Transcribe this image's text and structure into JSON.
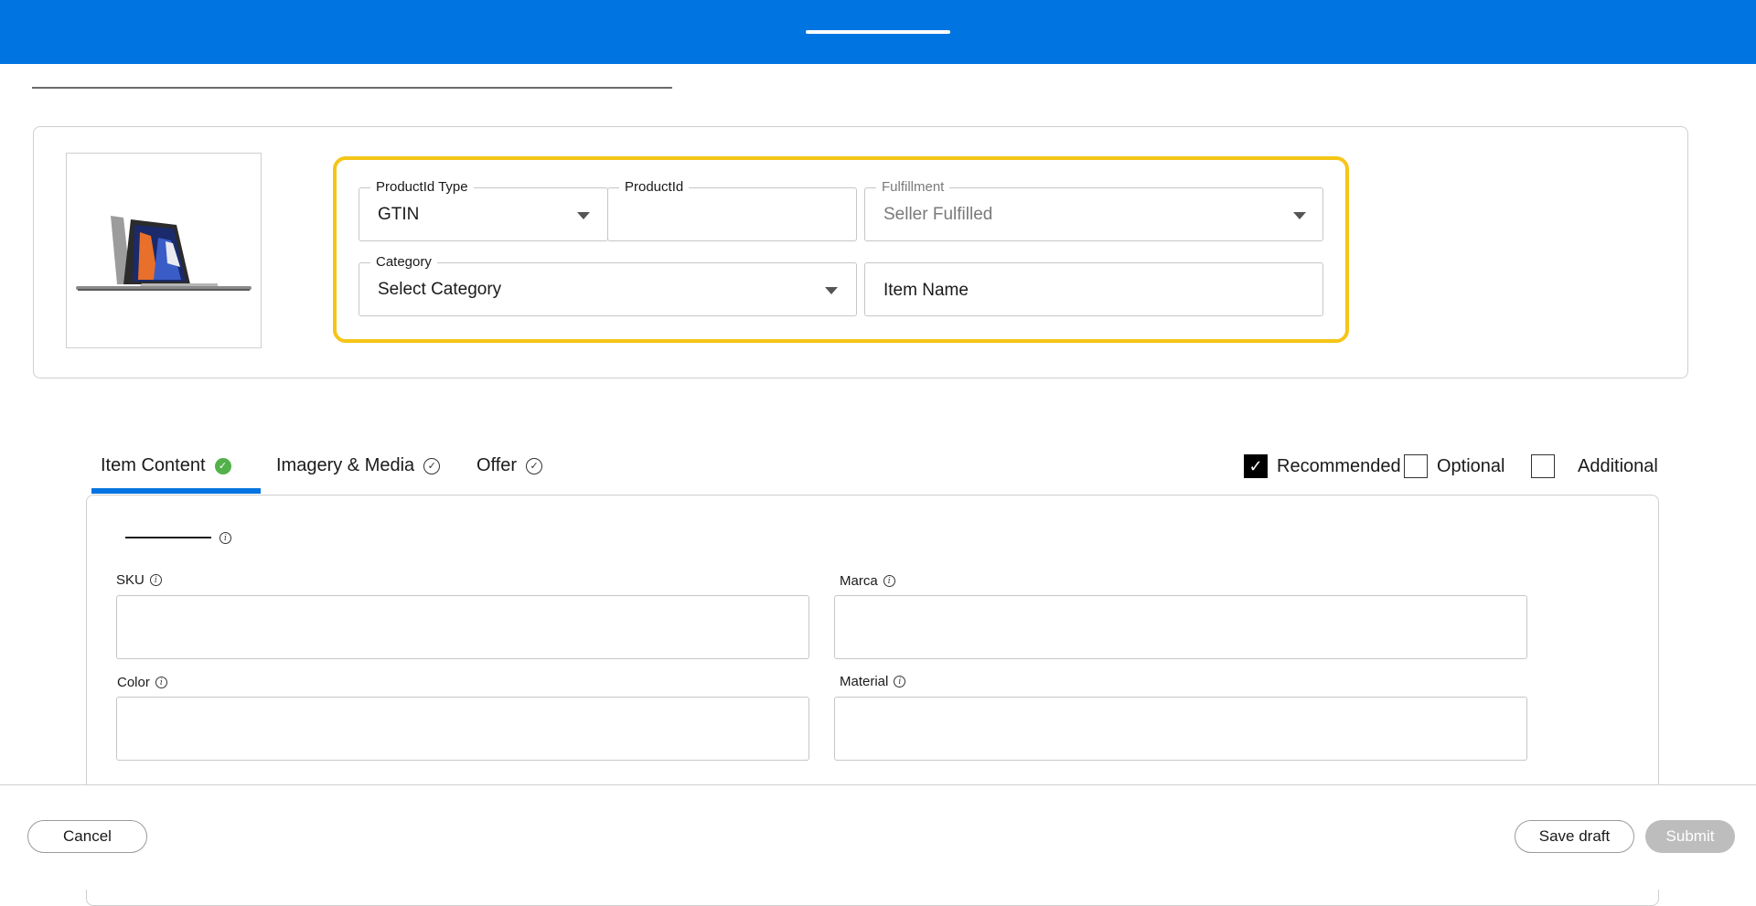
{
  "product_setup": {
    "productid_type": {
      "label": "ProductId Type",
      "value": "GTIN"
    },
    "productid": {
      "label": "ProductId",
      "value": ""
    },
    "fulfillment": {
      "label": "Fulfillment",
      "value": "Seller Fulfilled"
    },
    "category": {
      "label": "Category",
      "value": "Select Category"
    },
    "item_name": {
      "placeholder": "Item Name"
    }
  },
  "tabs": [
    {
      "label": "Item Content",
      "status": "complete",
      "active": true
    },
    {
      "label": "Imagery & Media",
      "status": "pending"
    },
    {
      "label": "Offer",
      "status": "pending"
    }
  ],
  "filters": [
    {
      "label": "Recommended",
      "checked": true
    },
    {
      "label": "Optional",
      "checked": false
    },
    {
      "label": "Additional",
      "checked": false
    }
  ],
  "fields": {
    "sku": {
      "label": "SKU",
      "value": ""
    },
    "marca": {
      "label": "Marca",
      "value": ""
    },
    "color": {
      "label": "Color",
      "value": ""
    },
    "material": {
      "label": "Material",
      "value": ""
    }
  },
  "footer": {
    "cancel_label": "Cancel",
    "save_draft_label": "Save draft",
    "submit_label": "Submit"
  },
  "colors": {
    "header": "#0074e0",
    "highlight": "#f5c518",
    "complete": "#53b14a"
  }
}
